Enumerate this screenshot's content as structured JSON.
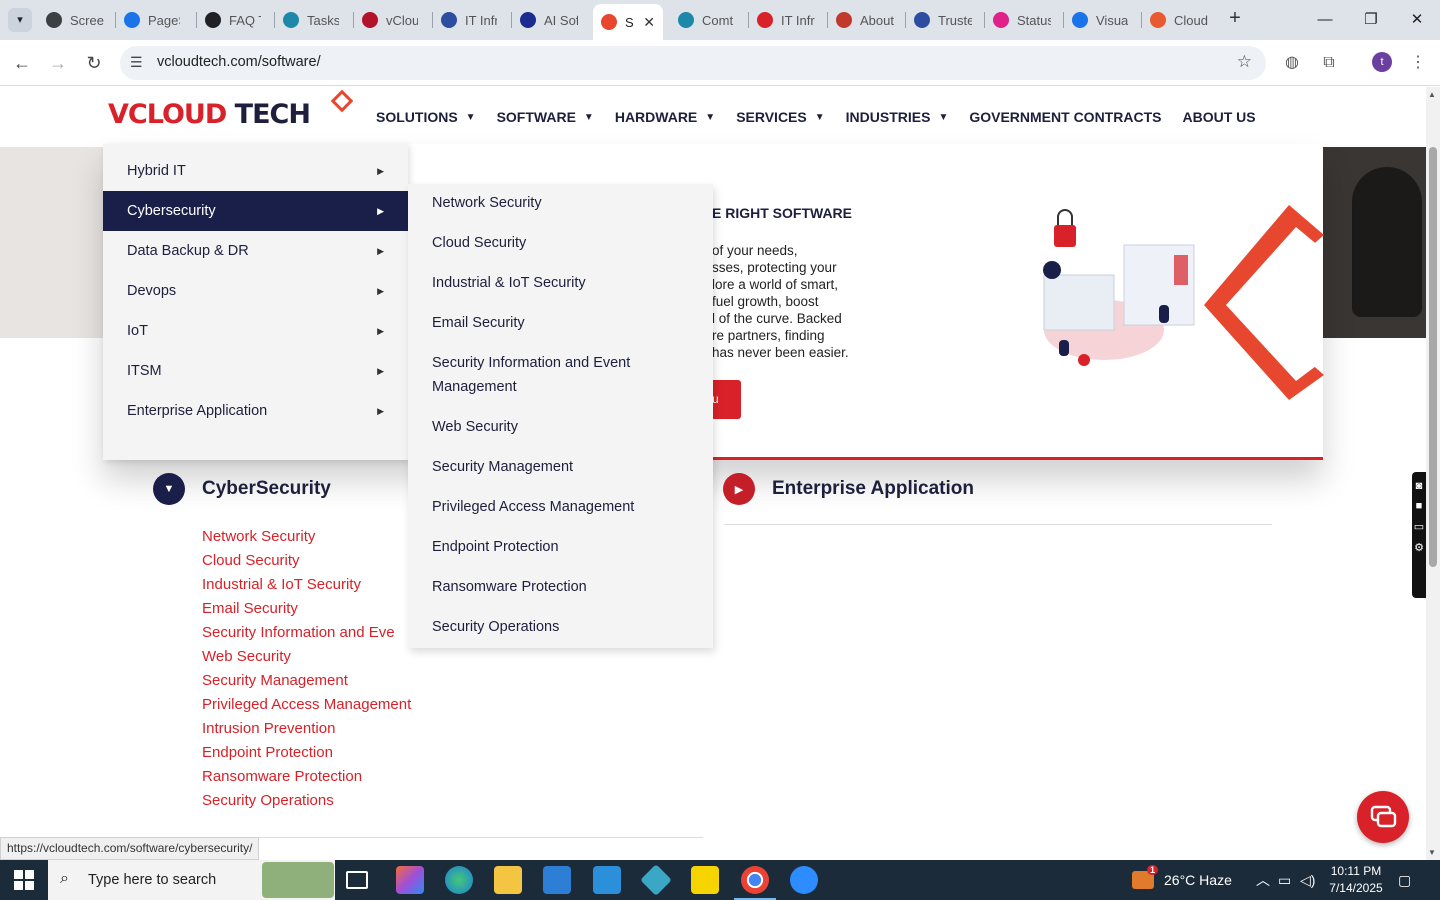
{
  "browser": {
    "tabs": [
      {
        "title": "Screen",
        "color": "#3c4043"
      },
      {
        "title": "PageS",
        "color": "#1a73e8"
      },
      {
        "title": "FAQ T",
        "color": "#202124"
      },
      {
        "title": "Tasks",
        "color": "#1e88a8"
      },
      {
        "title": "vClou",
        "color": "#b3122b"
      },
      {
        "title": "IT Infr",
        "color": "#2d4da0"
      },
      {
        "title": "AI Sof",
        "color": "#1a2c8f"
      },
      {
        "title": "Sc",
        "color": "#e8472f"
      },
      {
        "title": "Comt",
        "color": "#1e88a8"
      },
      {
        "title": "IT Infr",
        "color": "#d82128"
      },
      {
        "title": "About",
        "color": "#c0392b"
      },
      {
        "title": "Truste",
        "color": "#2d4da0"
      },
      {
        "title": "Status",
        "color": "#e0218a"
      },
      {
        "title": "Visua",
        "color": "#1a73e8"
      },
      {
        "title": "Cloud",
        "color": "#e85a2f"
      }
    ],
    "url": "vcloudtech.com/software/",
    "profile_initial": "t",
    "status_url": "https://vcloudtech.com/software/cybersecurity/"
  },
  "site": {
    "logo_main": "VCLOUD",
    "logo_tech": "TECH",
    "nav": [
      {
        "label": "SOLUTIONS",
        "has_caret": true
      },
      {
        "label": "SOFTWARE",
        "has_caret": true
      },
      {
        "label": "HARDWARE",
        "has_caret": true
      },
      {
        "label": "SERVICES",
        "has_caret": true
      },
      {
        "label": "INDUSTRIES",
        "has_caret": true
      },
      {
        "label": "GOVERNMENT CONTRACTS",
        "has_caret": false
      },
      {
        "label": "ABOUT US",
        "has_caret": false
      }
    ],
    "hero": {
      "title_fragment": "E RIGHT SOFTWARE",
      "text_fragments": [
        "of your needs,",
        "sses, protecting your",
        "lore a world of smart,",
        "fuel growth, boost",
        "l of the curve. Backed",
        "re partners, finding",
        "has never been easier."
      ],
      "cta_fragment": "u"
    },
    "dropdown_level1": [
      {
        "label": "Hybrid IT",
        "selected": false
      },
      {
        "label": "Cybersecurity",
        "selected": true
      },
      {
        "label": "Data Backup & DR",
        "selected": false
      },
      {
        "label": "Devops",
        "selected": false
      },
      {
        "label": "IoT",
        "selected": false
      },
      {
        "label": "ITSM",
        "selected": false
      },
      {
        "label": "Enterprise Application",
        "selected": false
      }
    ],
    "dropdown_level2": [
      "Network Security",
      "Cloud Security",
      "Industrial & IoT Security",
      "Email Security",
      "Security Information and Event Management",
      "Web Security",
      "Security Management",
      "Privileged Access Management",
      "Endpoint Protection",
      "Ransomware Protection",
      "Security Operations"
    ],
    "sections": {
      "left_title": "CyberSecurity",
      "right_title": "Enterprise Application"
    },
    "cyber_links": [
      "Network Security",
      "Cloud Security",
      "Industrial & IoT Security",
      "Email Security",
      "Security Information and Eve",
      "Web Security",
      "Security Management",
      "Privileged Access Management",
      "Intrusion Prevention",
      "Endpoint Protection",
      "Ransomware Protection",
      "Security Operations"
    ],
    "colors": {
      "brand_red": "#d82128",
      "navy": "#1d1f3d",
      "selected_bg": "#1a1f4a"
    }
  },
  "taskbar": {
    "search_placeholder": "Type here to search",
    "weather": "26°C  Haze",
    "weather_badge": "1",
    "time": "10:11 PM",
    "date": "7/14/2025"
  }
}
